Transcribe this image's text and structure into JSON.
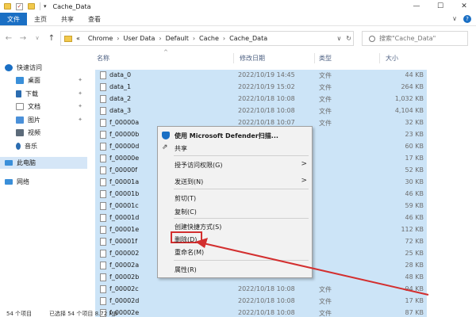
{
  "window": {
    "title": "Cache_Data",
    "controls": [
      "—",
      "☐",
      "✕"
    ]
  },
  "quick_access": {
    "dropdown": "▾"
  },
  "ribbon": {
    "tabs": [
      "文件",
      "主页",
      "共享",
      "查看"
    ],
    "expand": "∨",
    "help": "?"
  },
  "nav": {
    "back": "←",
    "forward": "→",
    "recent": "∨",
    "up": "↑"
  },
  "address": {
    "prefix": "«",
    "crumbs": [
      "Chrome",
      "User Data",
      "Default",
      "Cache",
      "Cache_Data"
    ],
    "dropdown": "∨",
    "refresh": "↻"
  },
  "search": {
    "placeholder": "搜索\"Cache_Data\""
  },
  "sidebar": {
    "items": [
      {
        "label": "快速访问",
        "icon": "star-icon",
        "color": "#1a6fc4"
      },
      {
        "label": "桌面",
        "icon": "desktop-icon",
        "color": "#3a8fd9",
        "pinned": true
      },
      {
        "label": "下载",
        "icon": "download-icon",
        "color": "#2b6cb0",
        "pinned": true
      },
      {
        "label": "文档",
        "icon": "document-icon",
        "color": "#8a8a8a",
        "pinned": true
      },
      {
        "label": "图片",
        "icon": "pictures-icon",
        "color": "#4a90d9",
        "pinned": true
      },
      {
        "label": "视频",
        "icon": "video-icon",
        "color": "#5c6b7a"
      },
      {
        "label": "音乐",
        "icon": "music-icon",
        "color": "#2b6cb0"
      },
      {
        "label": "此电脑",
        "icon": "computer-icon",
        "color": "#3a8fd9"
      },
      {
        "label": "网络",
        "icon": "network-icon",
        "color": "#3a8fd9"
      }
    ],
    "pin_glyph": "📌"
  },
  "columns": {
    "name": "名称",
    "date": "修改日期",
    "type": "类型",
    "size": "大小",
    "sort": "^"
  },
  "files": [
    {
      "name": "data_0",
      "date": "2022/10/19 14:45",
      "type": "文件",
      "size": "44 KB"
    },
    {
      "name": "data_1",
      "date": "2022/10/19 15:02",
      "type": "文件",
      "size": "264 KB"
    },
    {
      "name": "data_2",
      "date": "2022/10/18 10:08",
      "type": "文件",
      "size": "1,032 KB"
    },
    {
      "name": "data_3",
      "date": "2022/10/18 10:08",
      "type": "文件",
      "size": "4,104 KB"
    },
    {
      "name": "f_00000a",
      "date": "2022/10/18 10:07",
      "type": "文件",
      "size": "32 KB"
    },
    {
      "name": "f_00000b",
      "date": "",
      "type": "",
      "size": "23 KB"
    },
    {
      "name": "f_00000d",
      "date": "",
      "type": "",
      "size": "60 KB"
    },
    {
      "name": "f_00000e",
      "date": "",
      "type": "",
      "size": "17 KB"
    },
    {
      "name": "f_00000f",
      "date": "",
      "type": "",
      "size": "52 KB"
    },
    {
      "name": "f_00001a",
      "date": "",
      "type": "",
      "size": "30 KB"
    },
    {
      "name": "f_00001b",
      "date": "",
      "type": "",
      "size": "46 KB"
    },
    {
      "name": "f_00001c",
      "date": "",
      "type": "",
      "size": "59 KB"
    },
    {
      "name": "f_00001d",
      "date": "",
      "type": "",
      "size": "46 KB"
    },
    {
      "name": "f_00001e",
      "date": "",
      "type": "",
      "size": "112 KB"
    },
    {
      "name": "f_00001f",
      "date": "",
      "type": "",
      "size": "72 KB"
    },
    {
      "name": "f_000002",
      "date": "",
      "type": "",
      "size": "25 KB"
    },
    {
      "name": "f_00002a",
      "date": "",
      "type": "",
      "size": "28 KB"
    },
    {
      "name": "f_00002b",
      "date": "",
      "type": "",
      "size": "48 KB"
    },
    {
      "name": "f_00002c",
      "date": "2022/10/18 10:08",
      "type": "文件",
      "size": "94 KB"
    },
    {
      "name": "f_00002d",
      "date": "2022/10/18 10:08",
      "type": "文件",
      "size": "17 KB"
    },
    {
      "name": "f_00002e",
      "date": "2022/10/18 10:08",
      "type": "文件",
      "size": "87 KB"
    }
  ],
  "context_menu": {
    "defender": "使用 Microsoft Defender扫描...",
    "share": "共享",
    "grant_access": "授予访问权限(G)",
    "send_to": "发送到(N)",
    "cut": "剪切(T)",
    "copy": "复制(C)",
    "create_shortcut": "创建快捷方式(S)",
    "delete": "删除(D)",
    "rename": "重命名(M)",
    "properties": "属性(R)",
    "submenu_arrow": ">",
    "share_glyph": "⇗"
  },
  "status": {
    "count": "54 个项目",
    "selected": "已选择 54 个项目  8.72 MB"
  },
  "colors": {
    "selection": "#cce4f7",
    "accent": "#1a6fc4",
    "annotation": "#d32f2f"
  }
}
